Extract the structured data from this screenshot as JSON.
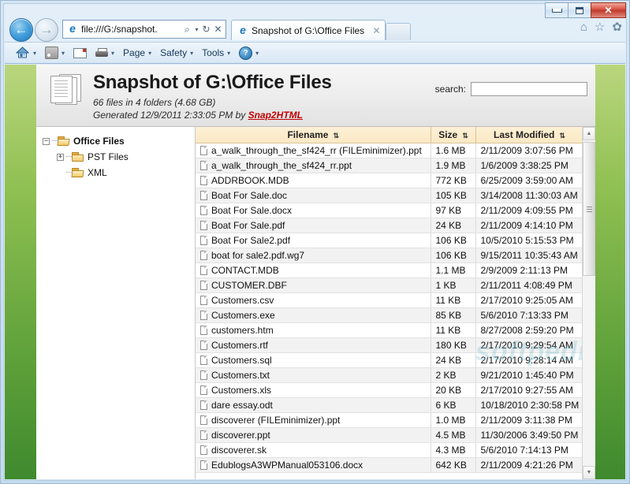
{
  "window": {
    "minimize_label": "Minimize",
    "maximize_label": "Restore",
    "close_label": "✕"
  },
  "browser": {
    "back_label": "←",
    "forward_label": "→",
    "address": {
      "value": "file:///G:/snapshot.",
      "search_icon": "⌕",
      "dropdown_icon": "▾",
      "refresh_icon": "↻",
      "stop_icon": "✕"
    },
    "tab": {
      "title": "Snapshot of G:\\Office Files",
      "close_icon": "✕"
    },
    "new_tab_label": "",
    "right_icons": [
      "home-icon",
      "favorites-icon",
      "tools-icon"
    ],
    "right_glyphs": [
      "⌂",
      "☆",
      "✿"
    ]
  },
  "commandbar": {
    "items": [
      {
        "name": "home",
        "label": "",
        "caret": "▾"
      },
      {
        "name": "feeds",
        "label": "",
        "caret": "▾"
      },
      {
        "name": "mail",
        "label": "",
        "caret": ""
      },
      {
        "name": "print",
        "label": "",
        "caret": "▾"
      },
      {
        "name": "page",
        "label": "Page",
        "caret": "▾"
      },
      {
        "name": "safety",
        "label": "Safety",
        "caret": "▾"
      },
      {
        "name": "tools",
        "label": "Tools",
        "caret": "▾"
      },
      {
        "name": "help",
        "label": "",
        "caret": "▾"
      }
    ],
    "help_glyph": "?"
  },
  "page": {
    "title": "Snapshot of G:\\Office Files",
    "subtitle": "66 files in 4 folders (4.68 GB)",
    "generated_prefix": "Generated 12/9/2011 2:33:05 PM by ",
    "generator_link": "Snap2HTML",
    "search_label": "search:",
    "search_value": "",
    "search_placeholder": "",
    "watermark": "softpedia"
  },
  "tree": {
    "nodes": [
      {
        "label": "Office Files",
        "level": 1,
        "expander": "−",
        "folder": "open",
        "bold": true
      },
      {
        "label": "PST Files",
        "level": 2,
        "expander": "+",
        "folder": "closed",
        "bold": false
      },
      {
        "label": "XML",
        "level": 2,
        "expander": "",
        "folder": "open",
        "bold": false
      }
    ]
  },
  "table": {
    "columns": [
      {
        "key": "name",
        "label": "Filename",
        "sort": "⇅"
      },
      {
        "key": "size",
        "label": "Size",
        "sort": "⇅"
      },
      {
        "key": "date",
        "label": "Last Modified",
        "sort": "⇅"
      }
    ],
    "rows": [
      {
        "name": "a_walk_through_the_sf424_rr (FILEminimizer).ppt",
        "size": "1.6 MB",
        "date": "2/11/2009 3:07:56 PM"
      },
      {
        "name": "a_walk_through_the_sf424_rr.ppt",
        "size": "1.9 MB",
        "date": "1/6/2009 3:38:25 PM"
      },
      {
        "name": "ADDRBOOK.MDB",
        "size": "772 KB",
        "date": "6/25/2009 3:59:00 AM"
      },
      {
        "name": "Boat For Sale.doc",
        "size": "105 KB",
        "date": "3/14/2008 11:30:03 AM"
      },
      {
        "name": "Boat For Sale.docx",
        "size": "97 KB",
        "date": "2/11/2009 4:09:55 PM"
      },
      {
        "name": "Boat For Sale.pdf",
        "size": "24 KB",
        "date": "2/11/2009 4:14:10 PM"
      },
      {
        "name": "Boat For Sale2.pdf",
        "size": "106 KB",
        "date": "10/5/2010 5:15:53 PM"
      },
      {
        "name": "boat for sale2.pdf.wg7",
        "size": "106 KB",
        "date": "9/15/2011 10:35:43 AM"
      },
      {
        "name": "CONTACT.MDB",
        "size": "1.1 MB",
        "date": "2/9/2009 2:11:13 PM"
      },
      {
        "name": "CUSTOMER.DBF",
        "size": "1 KB",
        "date": "2/11/2011 4:08:49 PM"
      },
      {
        "name": "Customers.csv",
        "size": "11 KB",
        "date": "2/17/2010 9:25:05 AM"
      },
      {
        "name": "Customers.exe",
        "size": "85 KB",
        "date": "5/6/2010 7:13:33 PM"
      },
      {
        "name": "customers.htm",
        "size": "11 KB",
        "date": "8/27/2008 2:59:20 PM"
      },
      {
        "name": "Customers.rtf",
        "size": "180 KB",
        "date": "2/17/2010 9:29:54 AM"
      },
      {
        "name": "Customers.sql",
        "size": "24 KB",
        "date": "2/17/2010 9:28:14 AM"
      },
      {
        "name": "Customers.txt",
        "size": "2 KB",
        "date": "9/21/2010 1:45:40 PM"
      },
      {
        "name": "Customers.xls",
        "size": "20 KB",
        "date": "2/17/2010 9:27:55 AM"
      },
      {
        "name": "dare essay.odt",
        "size": "6 KB",
        "date": "10/18/2010 2:30:58 PM"
      },
      {
        "name": "discoverer (FILEminimizer).ppt",
        "size": "1.0 MB",
        "date": "2/11/2009 3:11:38 PM"
      },
      {
        "name": "discoverer.ppt",
        "size": "4.5 MB",
        "date": "11/30/2006 3:49:50 PM"
      },
      {
        "name": "discoverer.sk",
        "size": "4.3 MB",
        "date": "5/6/2010 7:14:13 PM"
      },
      {
        "name": "EdublogsA3WPManual053106.docx",
        "size": "642 KB",
        "date": "2/11/2009 4:21:26 PM"
      }
    ],
    "scroll_up_icon": "▲",
    "scroll_down_icon": "▼"
  },
  "colors": {
    "header_gold": "#fbe9c4",
    "link_red": "#c00000",
    "green_start": "#bad67e",
    "green_end": "#3f8a2e"
  }
}
